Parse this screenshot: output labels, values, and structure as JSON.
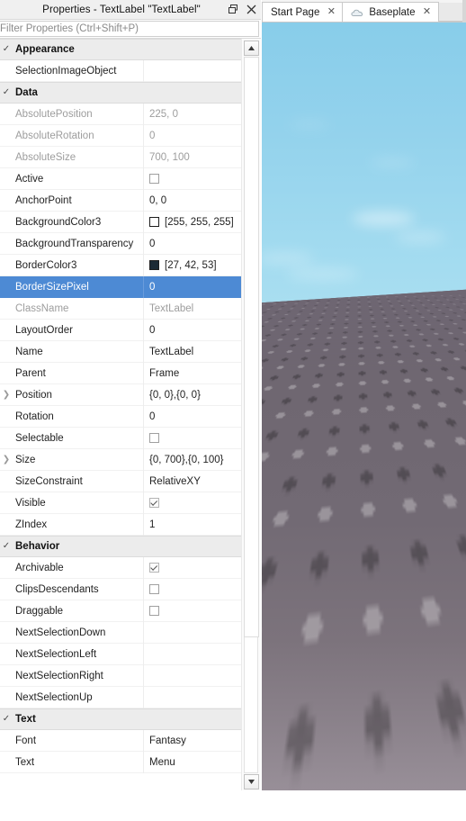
{
  "properties_panel": {
    "title": "Properties - TextLabel \"TextLabel\"",
    "window_buttons": {
      "float_label": "Float / Restore",
      "close_label": "Close"
    },
    "filter": {
      "value": "",
      "placeholder": "Filter Properties (Ctrl+Shift+P)"
    },
    "selected_row": "BorderSizePixel",
    "rows": [
      {
        "kind": "category",
        "name": "Appearance",
        "checked": true
      },
      {
        "kind": "prop",
        "name": "SelectionImageObject",
        "value": "",
        "dim": false,
        "type": "text"
      },
      {
        "kind": "category",
        "name": "Data",
        "checked": true
      },
      {
        "kind": "prop",
        "name": "AbsolutePosition",
        "value": "225, 0",
        "dim": true,
        "type": "text"
      },
      {
        "kind": "prop",
        "name": "AbsoluteRotation",
        "value": "0",
        "dim": true,
        "type": "text"
      },
      {
        "kind": "prop",
        "name": "AbsoluteSize",
        "value": "700, 100",
        "dim": true,
        "type": "text"
      },
      {
        "kind": "prop",
        "name": "Active",
        "value": "",
        "dim": false,
        "type": "checkbox",
        "checked": false
      },
      {
        "kind": "prop",
        "name": "AnchorPoint",
        "value": "0, 0",
        "dim": false,
        "type": "text"
      },
      {
        "kind": "prop",
        "name": "BackgroundColor3",
        "value": "[255, 255, 255]",
        "dim": false,
        "type": "color",
        "swatch": "#ffffff"
      },
      {
        "kind": "prop",
        "name": "BackgroundTransparency",
        "value": "0",
        "dim": false,
        "type": "text"
      },
      {
        "kind": "prop",
        "name": "BorderColor3",
        "value": "[27, 42, 53]",
        "dim": false,
        "type": "color",
        "swatch": "#1b2a35"
      },
      {
        "kind": "prop",
        "name": "BorderSizePixel",
        "value": "0",
        "dim": false,
        "type": "text",
        "selected": true
      },
      {
        "kind": "prop",
        "name": "ClassName",
        "value": "TextLabel",
        "dim": true,
        "type": "text"
      },
      {
        "kind": "prop",
        "name": "LayoutOrder",
        "value": "0",
        "dim": false,
        "type": "text"
      },
      {
        "kind": "prop",
        "name": "Name",
        "value": "TextLabel",
        "dim": false,
        "type": "text"
      },
      {
        "kind": "prop",
        "name": "Parent",
        "value": "Frame",
        "dim": false,
        "type": "text"
      },
      {
        "kind": "prop",
        "name": "Position",
        "value": "{0, 0},{0, 0}",
        "dim": false,
        "type": "text",
        "expandable": true
      },
      {
        "kind": "prop",
        "name": "Rotation",
        "value": "0",
        "dim": false,
        "type": "text"
      },
      {
        "kind": "prop",
        "name": "Selectable",
        "value": "",
        "dim": false,
        "type": "checkbox",
        "checked": false
      },
      {
        "kind": "prop",
        "name": "Size",
        "value": "{0, 700},{0, 100}",
        "dim": false,
        "type": "text",
        "expandable": true
      },
      {
        "kind": "prop",
        "name": "SizeConstraint",
        "value": "RelativeXY",
        "dim": false,
        "type": "text"
      },
      {
        "kind": "prop",
        "name": "Visible",
        "value": "",
        "dim": false,
        "type": "checkbox",
        "checked": true
      },
      {
        "kind": "prop",
        "name": "ZIndex",
        "value": "1",
        "dim": false,
        "type": "text"
      },
      {
        "kind": "category",
        "name": "Behavior",
        "checked": true
      },
      {
        "kind": "prop",
        "name": "Archivable",
        "value": "",
        "dim": false,
        "type": "checkbox",
        "checked": true
      },
      {
        "kind": "prop",
        "name": "ClipsDescendants",
        "value": "",
        "dim": false,
        "type": "checkbox",
        "checked": false
      },
      {
        "kind": "prop",
        "name": "Draggable",
        "value": "",
        "dim": false,
        "type": "checkbox",
        "checked": false
      },
      {
        "kind": "prop",
        "name": "NextSelectionDown",
        "value": "",
        "dim": false,
        "type": "text"
      },
      {
        "kind": "prop",
        "name": "NextSelectionLeft",
        "value": "",
        "dim": false,
        "type": "text"
      },
      {
        "kind": "prop",
        "name": "NextSelectionRight",
        "value": "",
        "dim": false,
        "type": "text"
      },
      {
        "kind": "prop",
        "name": "NextSelectionUp",
        "value": "",
        "dim": false,
        "type": "text"
      },
      {
        "kind": "category",
        "name": "Text",
        "checked": true
      },
      {
        "kind": "prop",
        "name": "Font",
        "value": "Fantasy",
        "dim": false,
        "type": "text"
      },
      {
        "kind": "prop",
        "name": "Text",
        "value": "Menu",
        "dim": false,
        "type": "text"
      }
    ],
    "scrollbar": {
      "up_arrow": "▲",
      "down_arrow": "▼"
    }
  },
  "viewport": {
    "tabs": [
      {
        "label": "Start Page",
        "close": "✕",
        "icon": "none",
        "active": true
      },
      {
        "label": "Baseplate",
        "close": "✕",
        "icon": "cloud-icon",
        "active": true
      }
    ],
    "scene": {
      "sky_top_color": "#88cdea",
      "sky_bottom_color": "#cfe9f2",
      "ground_color": "#6e6672"
    }
  }
}
